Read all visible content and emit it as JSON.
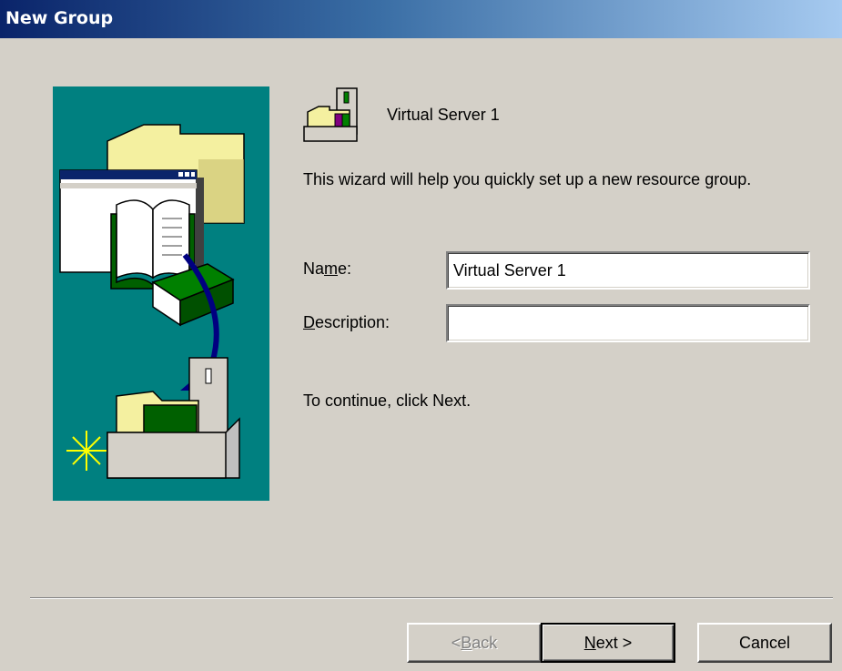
{
  "window": {
    "title": "New Group"
  },
  "header": {
    "title": "Virtual Server 1",
    "icon": "server-folder-icon"
  },
  "intro_text": "This wizard will help you quickly set up a new resource group.",
  "form": {
    "name_label_pre": "Na",
    "name_label_accel": "m",
    "name_label_post": "e:",
    "name_value": "Virtual Server 1",
    "description_label_accel": "D",
    "description_label_post": "escription:",
    "description_value": ""
  },
  "continue_text": "To continue, click Next.",
  "buttons": {
    "back_pre": "< ",
    "back_accel": "B",
    "back_post": "ack",
    "next_accel": "N",
    "next_post": "ext >",
    "cancel": "Cancel"
  },
  "colors": {
    "title_bar_start": "#0a246a",
    "art_background": "#008080",
    "dialog_face": "#d4d0c8"
  }
}
